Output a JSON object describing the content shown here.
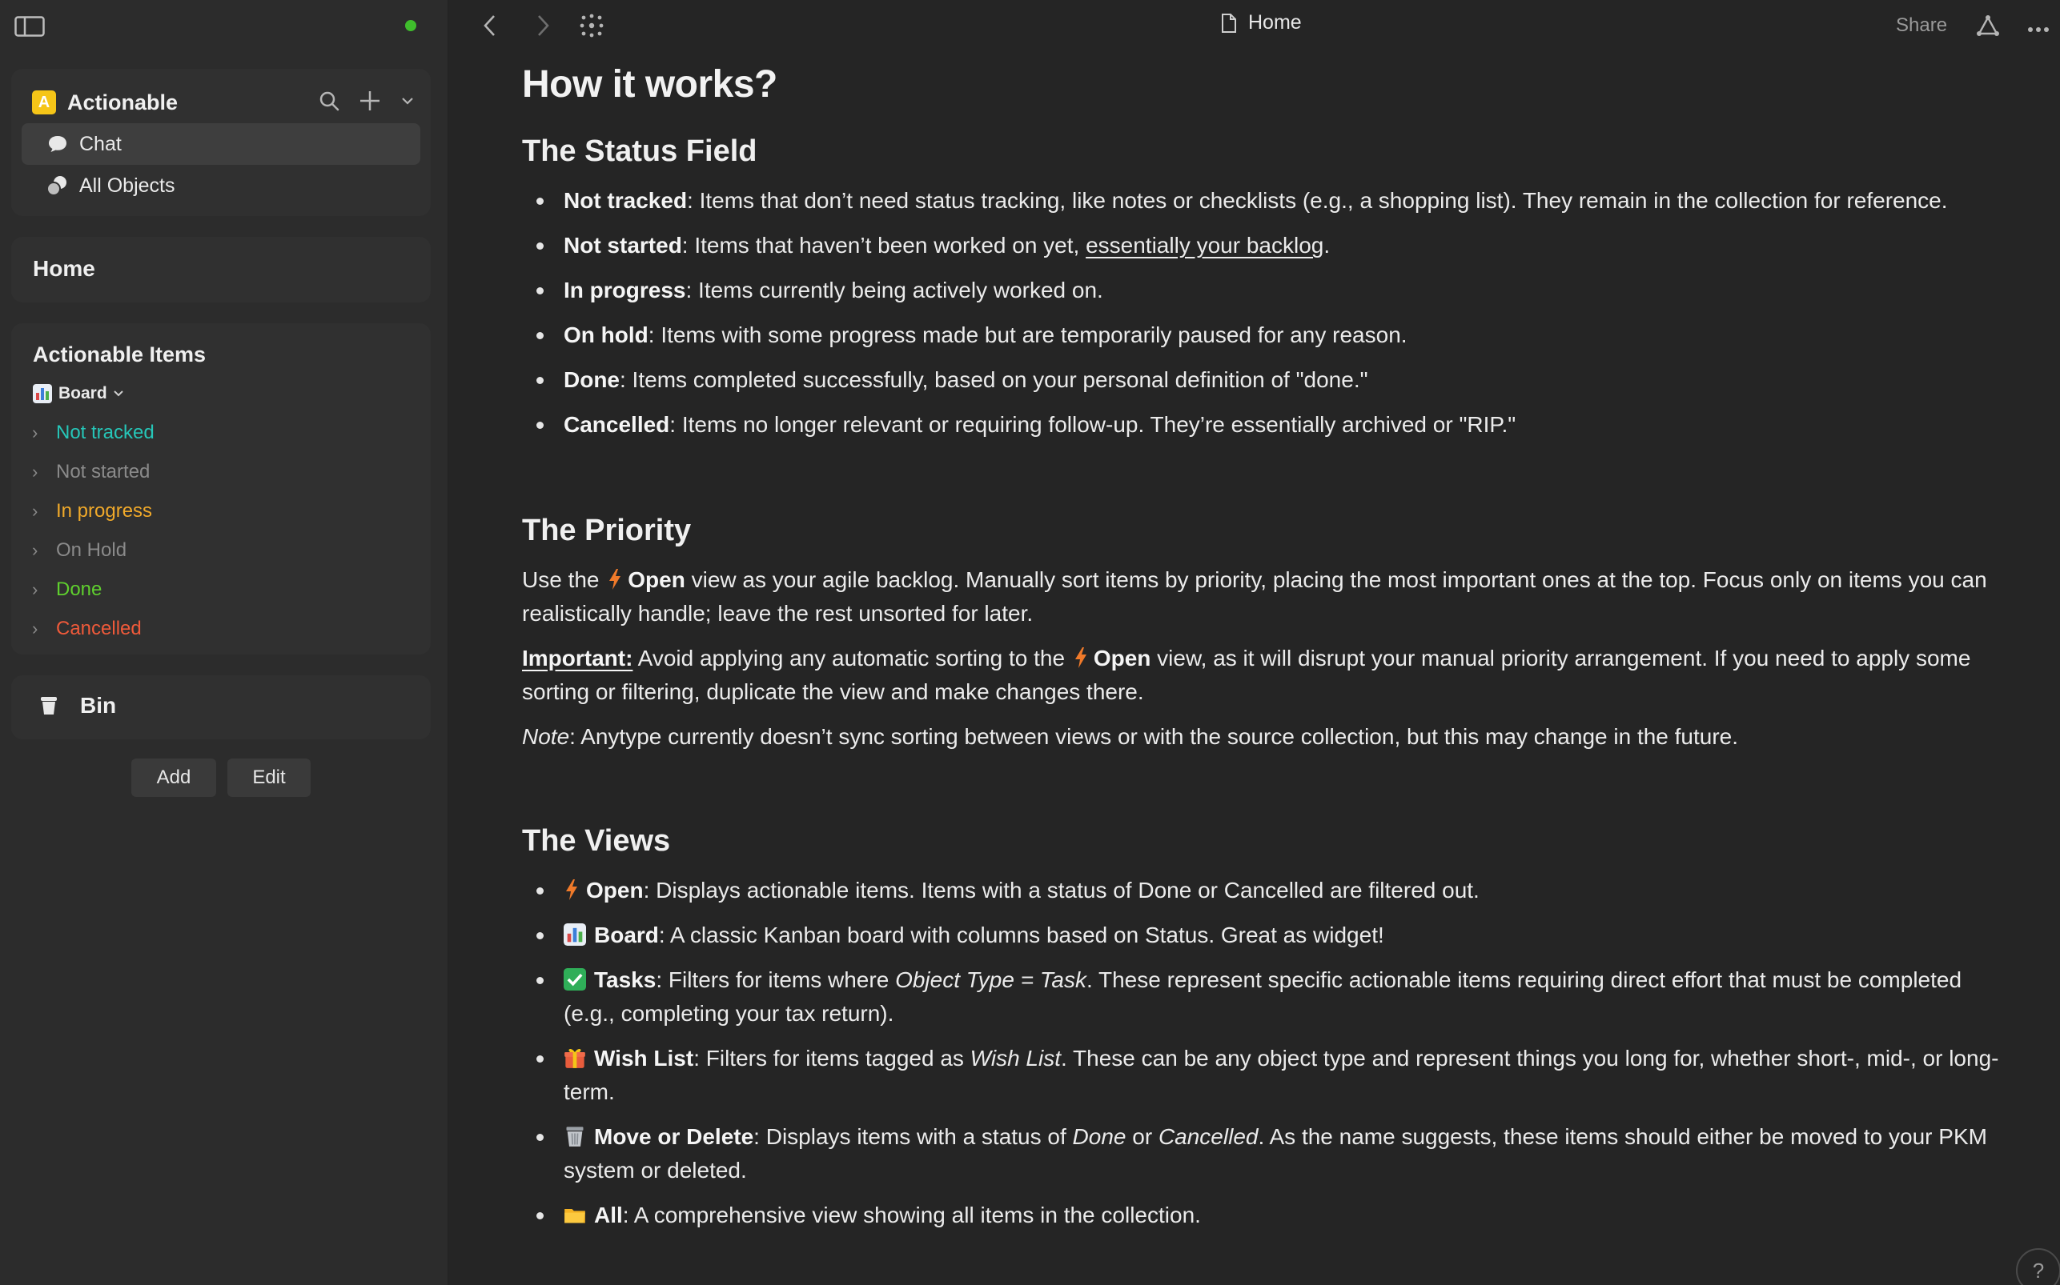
{
  "colors": {
    "accent_yellow": "#f5c518",
    "status_not_tracked": "#26c6b8",
    "status_not_started": "#8a8a8a",
    "status_in_progress": "#f0a92a",
    "status_on_hold": "#8a8a8a",
    "status_done": "#5fcf2e",
    "status_cancelled": "#ef5a3a",
    "sync_dot": "#3fbd2c"
  },
  "sidebar": {
    "space": {
      "badge": "A",
      "name": "Actionable"
    },
    "nav": [
      {
        "label": "Chat",
        "icon": "chat-bubble-icon"
      },
      {
        "label": "All Objects",
        "icon": "objects-icon"
      }
    ],
    "home": "Home",
    "actionable_items": {
      "title": "Actionable Items",
      "view": "Board",
      "statuses": [
        {
          "label": "Not tracked"
        },
        {
          "label": "Not started"
        },
        {
          "label": "In progress"
        },
        {
          "label": "On Hold"
        },
        {
          "label": "Done"
        },
        {
          "label": "Cancelled"
        }
      ]
    },
    "bin": "Bin",
    "buttons": {
      "add": "Add",
      "edit": "Edit"
    }
  },
  "topbar": {
    "doc_title": "Home",
    "share": "Share"
  },
  "content": {
    "title": "How it works?",
    "status_section": {
      "heading": "The Status Field",
      "items": [
        {
          "term": "Not tracked",
          "text": ": Items that don’t need status tracking, like notes or checklists (e.g., a shopping list). They remain in the collection for reference."
        },
        {
          "term": "Not started",
          "text": ": Items that haven’t been worked on yet, ",
          "link": "essentially your backlog",
          "tail": "."
        },
        {
          "term": "In progress",
          "text": ": Items currently being actively worked on."
        },
        {
          "term": "On hold",
          "text": ": Items with some progress made but are temporarily paused for any reason."
        },
        {
          "term": "Done",
          "text": ": Items completed successfully, based on your personal definition of \"done.\""
        },
        {
          "term": "Cancelled",
          "text": ": Items no longer relevant or requiring follow-up. They’re essentially archived or \"RIP.\""
        }
      ]
    },
    "priority_section": {
      "heading": "The Priority",
      "p1_pre": "Use the ",
      "p1_term": "Open",
      "p1_post": " view as your agile backlog. Manually sort items by priority, placing the most important ones at the top. Focus only on items you can realistically handle; leave the rest unsorted for later.",
      "p2_term": "Important:",
      "p2_pre": " Avoid applying any automatic sorting to the ",
      "p2_view": "Open",
      "p2_post": " view, as it will disrupt your manual priority arrangement. If you need to apply some sorting or filtering, duplicate the view and make changes there.",
      "p3_term": "Note",
      "p3_post": ": Anytype currently doesn’t sync sorting between views or with the source collection, but this may change in the future."
    },
    "views_section": {
      "heading": "The Views",
      "open_term": "Open",
      "open_text": ": Displays actionable items. Items with a status of Done or Cancelled are filtered out.",
      "board_term": "Board",
      "board_text": ": A classic Kanban board with columns based on Status. Great as widget!",
      "tasks_term": "Tasks",
      "tasks_pre": ": Filters for items where ",
      "tasks_italic": "Object Type = Task",
      "tasks_post": ". These represent specific actionable items requiring direct effort that must be completed (e.g., completing your tax return).",
      "wish_term": "Wish List",
      "wish_pre": ": Filters for items tagged as ",
      "wish_italic": "Wish List",
      "wish_post": ". These can be any object type and represent things you long for, whether short-, mid-, or long-term.",
      "move_term": "Move or Delete",
      "move_pre": ": Displays items with a status of ",
      "move_i1": "Done",
      "move_mid": " or ",
      "move_i2": "Cancelled",
      "move_post": ". As the name suggests, these items should either be moved to your PKM system or deleted.",
      "all_term": "All",
      "all_text": ": A comprehensive view showing all items in the collection."
    }
  },
  "help": "?"
}
